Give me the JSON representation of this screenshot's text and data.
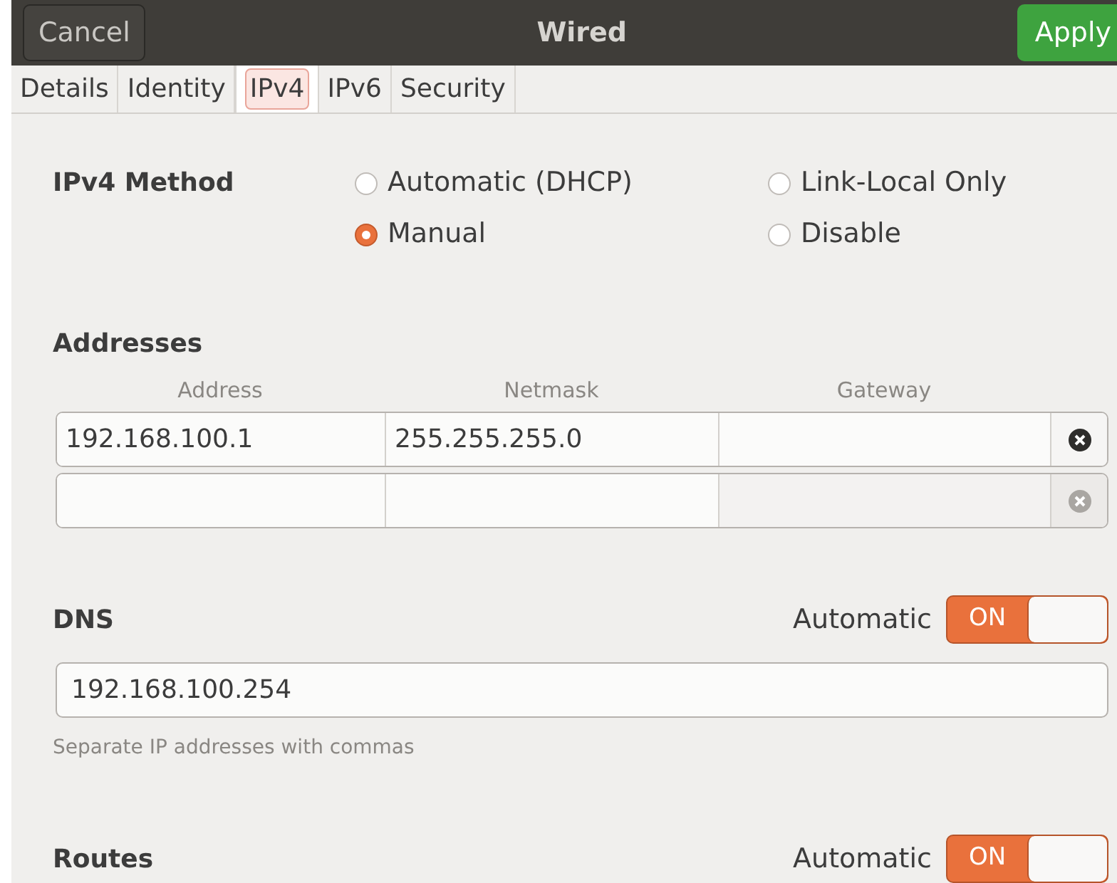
{
  "header": {
    "cancel": "Cancel",
    "title": "Wired",
    "apply": "Apply"
  },
  "tabs": [
    {
      "label": "Details",
      "selected": false
    },
    {
      "label": "Identity",
      "selected": false
    },
    {
      "label": "IPv4",
      "selected": true
    },
    {
      "label": "IPv6",
      "selected": false
    },
    {
      "label": "Security",
      "selected": false
    }
  ],
  "method": {
    "label": "IPv4 Method",
    "options": [
      {
        "label": "Automatic (DHCP)",
        "selected": false
      },
      {
        "label": "Link-Local Only",
        "selected": false
      },
      {
        "label": "Manual",
        "selected": true
      },
      {
        "label": "Disable",
        "selected": false
      }
    ]
  },
  "addresses": {
    "label": "Addresses",
    "columns": [
      "Address",
      "Netmask",
      "Gateway"
    ],
    "rows": [
      {
        "address": "192.168.100.1",
        "netmask": "255.255.255.0",
        "disabled": false
      },
      {
        "disabled": true
      }
    ]
  },
  "dns": {
    "label": "DNS",
    "automatic_label": "Automatic",
    "switch": {
      "text": "ON",
      "on": true
    },
    "value": "192.168.100.254",
    "hint": "Separate IP addresses with commas"
  },
  "routes": {
    "label": "Routes",
    "automatic_label": "Automatic",
    "switch": {
      "text": "ON",
      "on": true
    }
  }
}
